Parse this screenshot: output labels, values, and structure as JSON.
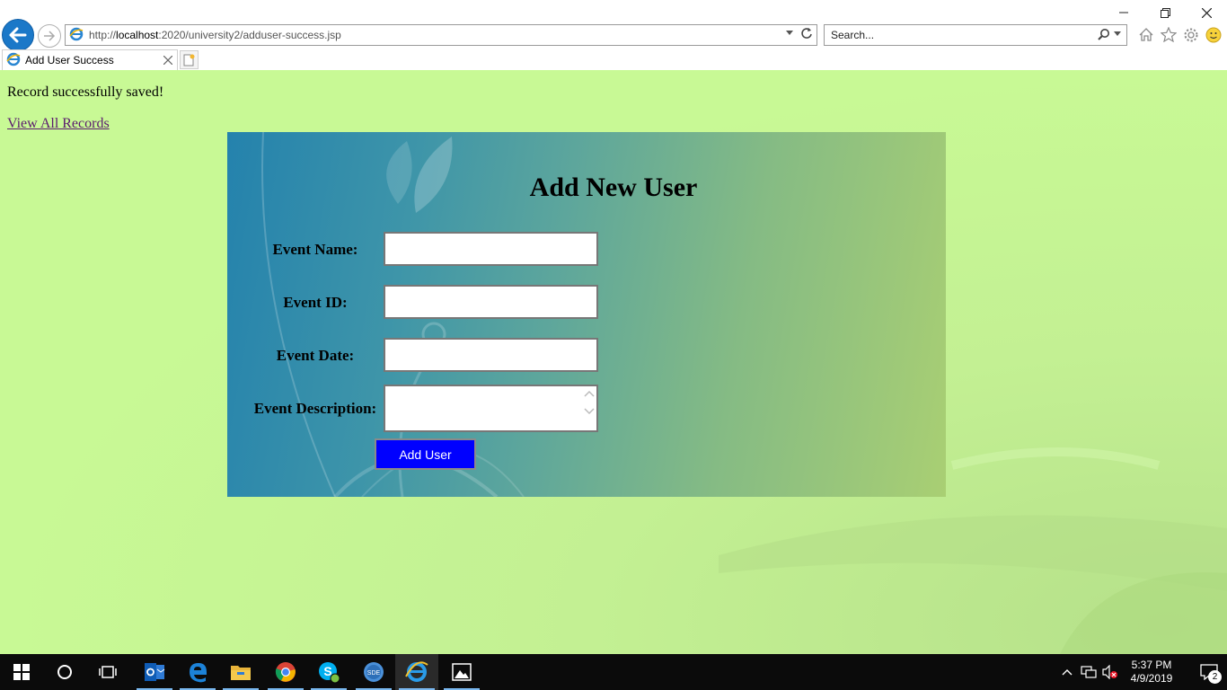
{
  "browser": {
    "url_prefix": "http://",
    "url_host": "localhost",
    "url_path": ":2020/university2/adduser-success.jsp",
    "search_placeholder": "Search...",
    "tab_title": "Add User Success"
  },
  "page": {
    "message": "Record successfully saved!",
    "link": "View All Records"
  },
  "form": {
    "title": "Add New User",
    "fields": [
      {
        "label": "Event Name:",
        "value": ""
      },
      {
        "label": "Event ID:",
        "value": ""
      },
      {
        "label": "Event Date:",
        "value": ""
      },
      {
        "label": "Event Description:",
        "value": ""
      }
    ],
    "submit": "Add User"
  },
  "taskbar": {
    "time": "5:37 PM",
    "date": "4/9/2019",
    "notifications": "2",
    "apps": [
      "start-icon",
      "cortana-icon",
      "task-view-icon",
      "outlook-icon",
      "edge-icon",
      "file-explorer-icon",
      "chrome-icon",
      "skype-icon",
      "sde-icon",
      "internet-explorer-icon",
      "photos-icon"
    ]
  },
  "colors": {
    "page_bg": "#c8f995",
    "button_bg": "#0000ff",
    "link": "#5a1a6e",
    "ie_blue": "#1b78c8"
  }
}
